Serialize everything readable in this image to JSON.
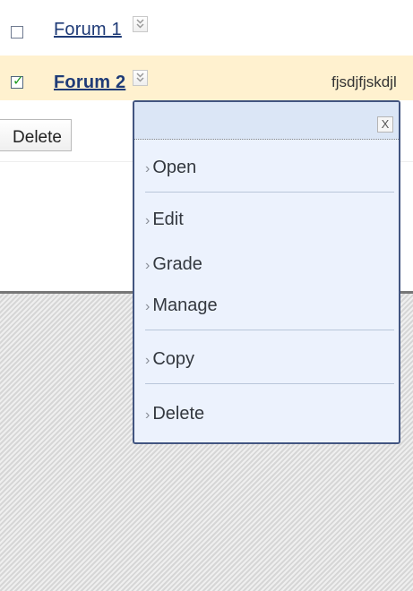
{
  "rows": [
    {
      "label": "Forum 1",
      "checked": false,
      "description": ""
    },
    {
      "label": "Forum 2",
      "checked": true,
      "description": "fjsdjfjskdjl"
    }
  ],
  "row_checkmark": "✓",
  "chevron_glyph": "⌄\n⌄",
  "delete_button": "Delete",
  "context_menu": {
    "close_label": "X",
    "items": [
      {
        "label": "Open",
        "arrow": "›"
      },
      {
        "label": "Edit",
        "arrow": "›"
      },
      {
        "label": "Grade",
        "arrow": "›"
      },
      {
        "label": "Manage",
        "arrow": "›"
      },
      {
        "label": "Copy",
        "arrow": "›"
      },
      {
        "label": "Delete",
        "arrow": "›"
      }
    ]
  },
  "colors": {
    "selected_row_bg": "#fff1cf",
    "link": "#1f3b77",
    "menu_border": "#425580",
    "menu_bg": "#ecf2fd",
    "menu_header_bg": "#dbe6f6"
  }
}
